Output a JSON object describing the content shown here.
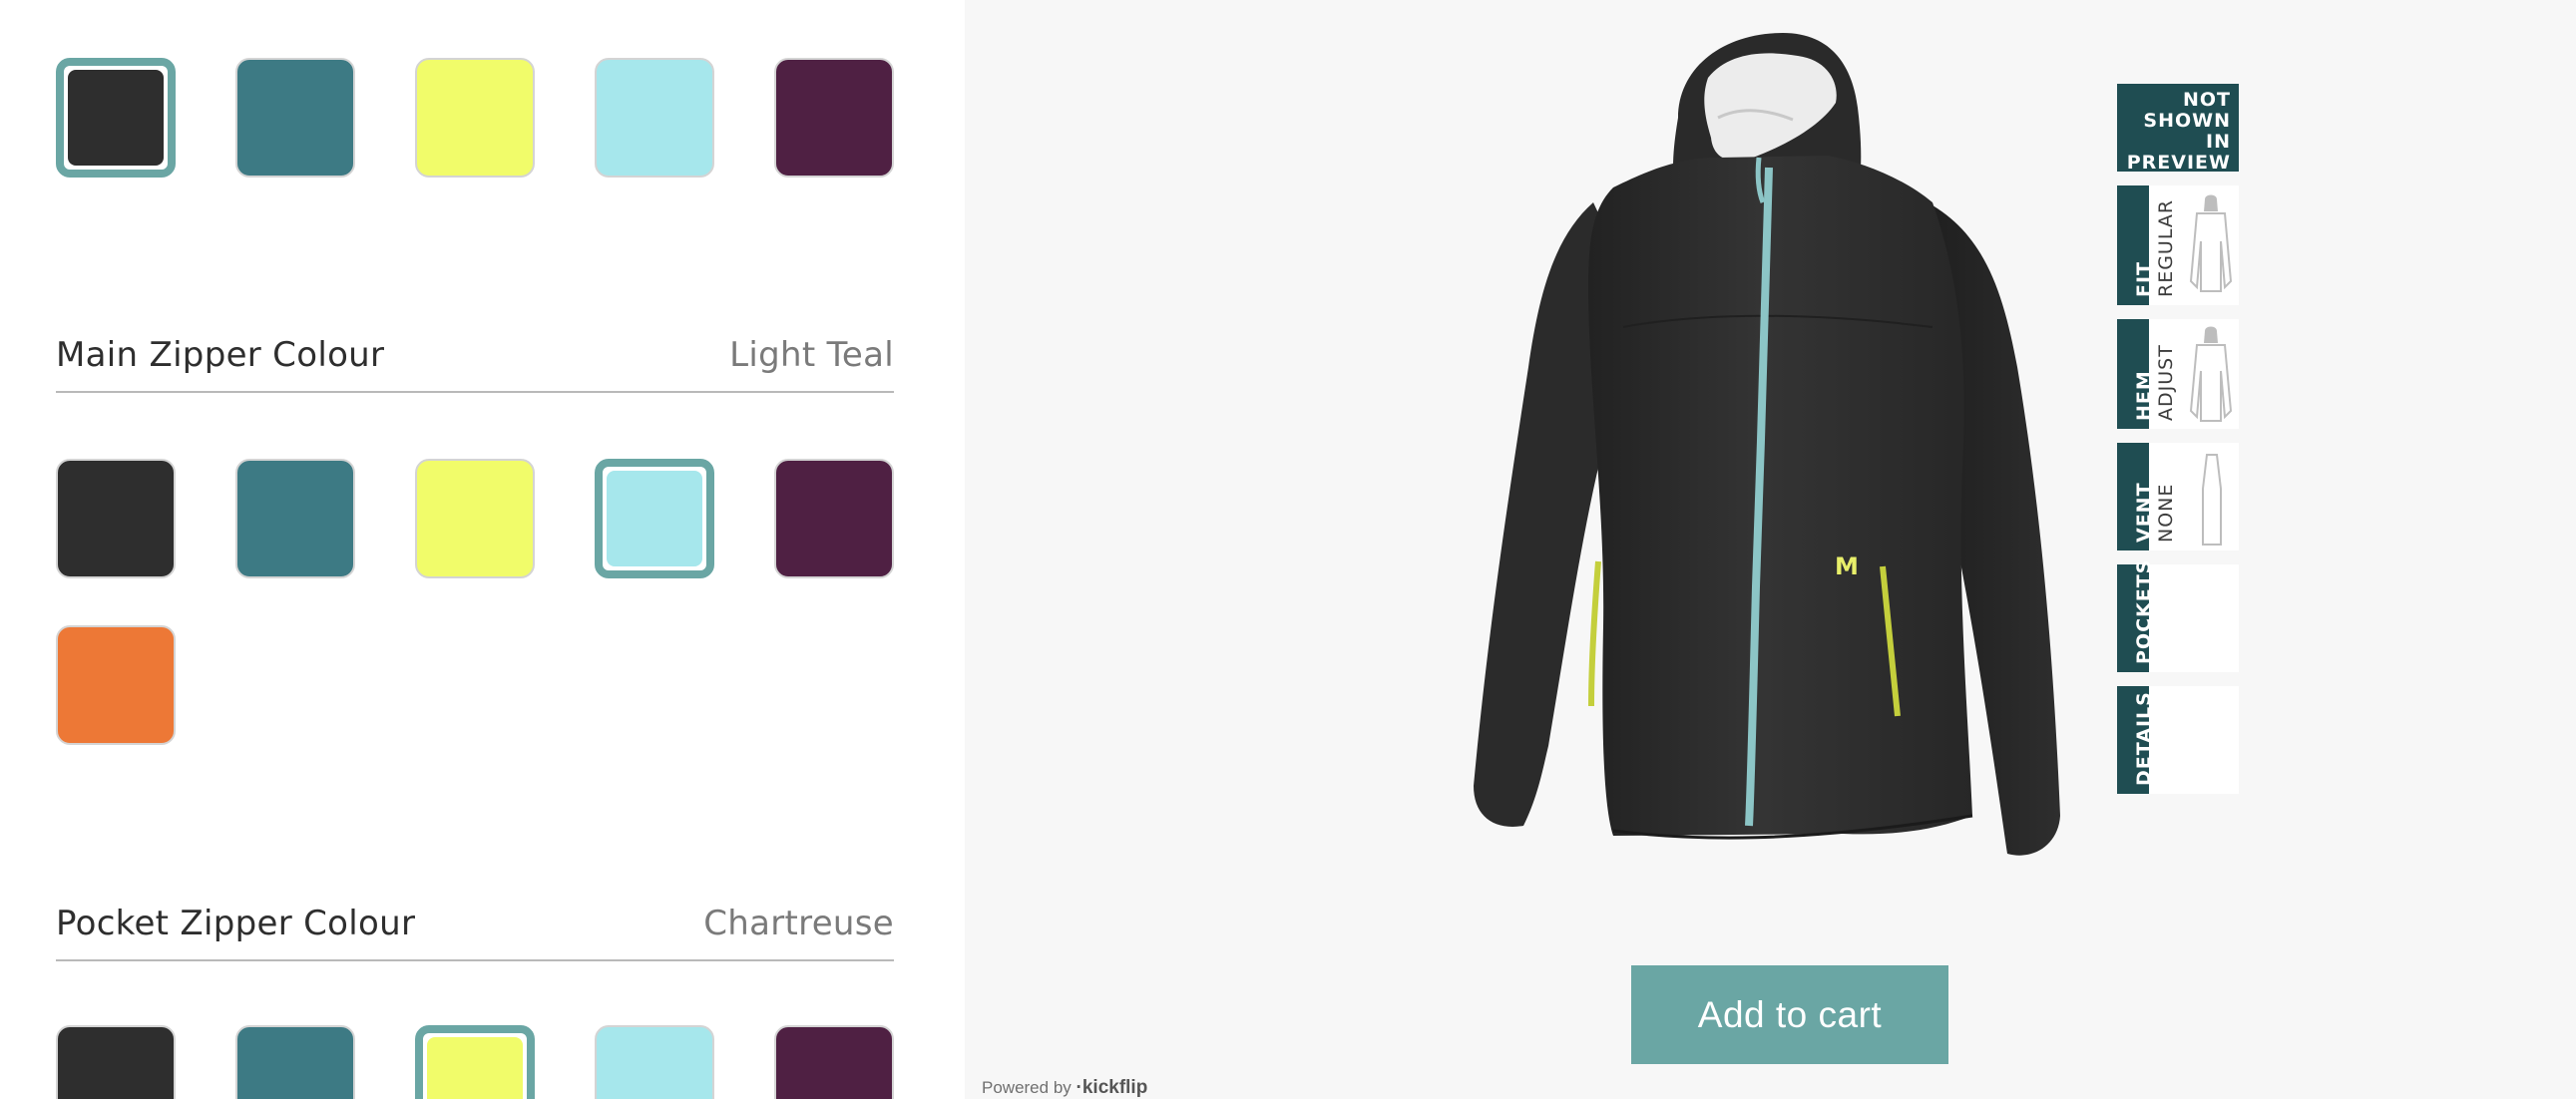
{
  "colors": {
    "black": "#2e2e2e",
    "teal": "#3d7a84",
    "chartreuse": "#f1fc6a",
    "light_teal": "#a6e7ec",
    "plum": "#4f2043",
    "orange": "#ed7836",
    "selected_border": "#6aa6a4",
    "card_dark": "#1f4d52"
  },
  "top_swatches": {
    "items": [
      {
        "name": "black",
        "selected": true
      },
      {
        "name": "teal",
        "selected": false
      },
      {
        "name": "chartreuse",
        "selected": false
      },
      {
        "name": "light_teal",
        "selected": false
      },
      {
        "name": "plum",
        "selected": false
      }
    ]
  },
  "main_zipper": {
    "title": "Main Zipper Colour",
    "value": "Light Teal",
    "items": [
      {
        "name": "black",
        "selected": false
      },
      {
        "name": "teal",
        "selected": false
      },
      {
        "name": "chartreuse",
        "selected": false
      },
      {
        "name": "light_teal",
        "selected": true
      },
      {
        "name": "plum",
        "selected": false
      },
      {
        "name": "orange",
        "selected": false
      }
    ]
  },
  "pocket_zipper": {
    "title": "Pocket Zipper Colour",
    "value": "Chartreuse",
    "items": [
      {
        "name": "black",
        "selected": false
      },
      {
        "name": "teal",
        "selected": false
      },
      {
        "name": "chartreuse",
        "selected": true
      },
      {
        "name": "light_teal",
        "selected": false
      },
      {
        "name": "plum",
        "selected": false
      }
    ]
  },
  "preview": {
    "not_shown_lines": [
      "NOT",
      "SHOWN",
      "IN",
      "PREVIEW"
    ],
    "cards": [
      {
        "label": "FIT",
        "value": "REGULAR",
        "thumb": "jacket-regular-icon"
      },
      {
        "label": "HEM",
        "value": "ADJUST",
        "thumb": "jacket-hem-icon"
      },
      {
        "label": "VENT",
        "value": "NONE",
        "thumb": "jacket-vent-icon"
      },
      {
        "label": "POCKETS",
        "value": "",
        "thumb": ""
      },
      {
        "label": "DETAILS",
        "value": "",
        "thumb": ""
      }
    ],
    "add_to_cart_label": "Add to cart",
    "powered_by": "Powered by",
    "powered_brand": "·kickflip"
  }
}
